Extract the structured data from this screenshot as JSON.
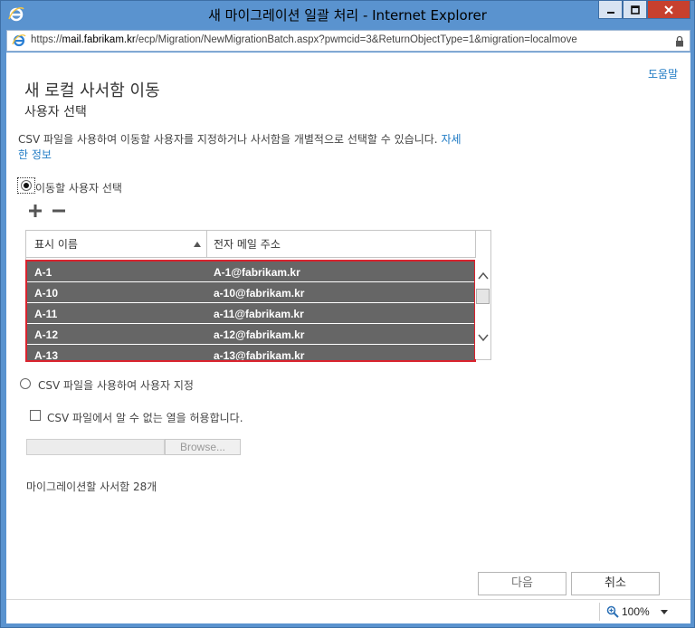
{
  "window": {
    "title": "새 마이그레이션 일괄 처리 - Internet Explorer"
  },
  "address": {
    "scheme": "https://",
    "host": "mail.fabrikam.kr",
    "path": "/ecp/Migration/NewMigrationBatch.aspx?pwmcid=3&ReturnObjectType=1&migration=localmove"
  },
  "page": {
    "help_link": "도움말",
    "heading": "새 로컬 사서함 이동",
    "subheading": "사용자 선택",
    "description": "CSV 파일을 사용하여 이동할 사용자를 지정하거나 사서함을 개별적으로 선택할 수 있습니다.",
    "description_link_1": "자세",
    "description_link_2": "한 정보"
  },
  "options": {
    "select_users_label": "이동할 사용자 선택",
    "csv_option_label": "CSV 파일을 사용하여 사용자 지정",
    "allow_unknown_columns_label": "CSV 파일에서 알 수 없는 열을 허용합니다.",
    "browse_label": "Browse..."
  },
  "grid": {
    "columns": [
      "표시 이름",
      "전자 메일 주소"
    ],
    "rows": [
      {
        "name": "A-1",
        "email": "A-1@fabrikam.kr"
      },
      {
        "name": "A-10",
        "email": "a-10@fabrikam.kr"
      },
      {
        "name": "A-11",
        "email": "a-11@fabrikam.kr"
      },
      {
        "name": "A-12",
        "email": "a-12@fabrikam.kr"
      },
      {
        "name": "A-13",
        "email": "a-13@fabrikam.kr"
      }
    ]
  },
  "summary": {
    "count_text": "마이그레이션할 사서함 28개"
  },
  "buttons": {
    "next": "다음",
    "cancel": "취소"
  },
  "statusbar": {
    "zoom": "100%"
  },
  "colors": {
    "frame": "#5a93cf",
    "link": "#1e7ac4",
    "selected_row": "#666666",
    "highlight_border": "#d9232e",
    "close_button": "#c7402e"
  }
}
